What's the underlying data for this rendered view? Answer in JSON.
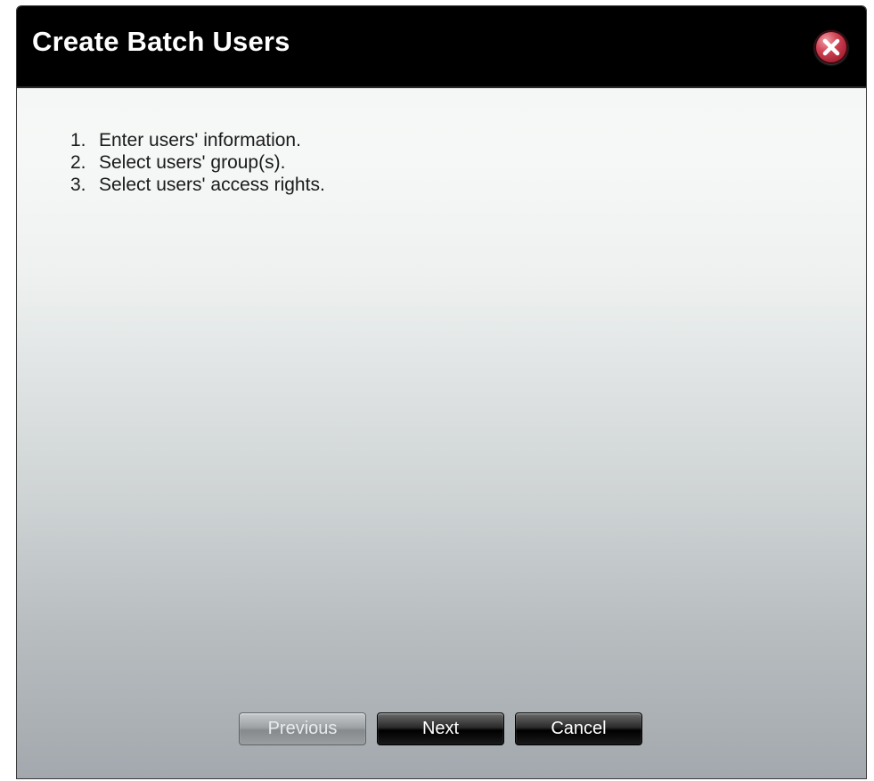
{
  "dialog": {
    "title": "Create Batch Users",
    "close_icon": "close-icon"
  },
  "steps": [
    {
      "number": "1.",
      "text": "Enter users' information."
    },
    {
      "number": "2.",
      "text": "Select users' group(s)."
    },
    {
      "number": "3.",
      "text": "Select users' access rights."
    }
  ],
  "buttons": {
    "previous": "Previous",
    "next": "Next",
    "cancel": "Cancel"
  }
}
